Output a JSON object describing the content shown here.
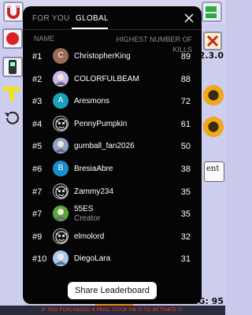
{
  "background": {
    "version": "2.3.0",
    "hint_text": "ent",
    "rank_display": "NG: 95",
    "bottom_notice": "IF YOU PURCHASED A PASS, CLICK ON IT TO ACTIVATE IT."
  },
  "leaderboard": {
    "tabs": [
      {
        "label": "FOR YOU",
        "active": false
      },
      {
        "label": "GLOBAL",
        "active": true
      }
    ],
    "columns": {
      "name": "NAME",
      "score": "HIGHEST NUMBER OF KILLS"
    },
    "entries": [
      {
        "rank": "#1",
        "name": "ChristopherKing",
        "kills": "89",
        "avatar": "letter",
        "avatar_letter": "C",
        "avatar_color": "#9b6b58"
      },
      {
        "rank": "#2",
        "name": "COLORFULBEAM",
        "kills": "88",
        "avatar": "image",
        "avatar_color": "#c8b8e8"
      },
      {
        "rank": "#3",
        "name": "Aresmons",
        "kills": "72",
        "avatar": "letter",
        "avatar_letter": "A",
        "avatar_color": "#17a2b8"
      },
      {
        "rank": "#4",
        "name": "PennyPumpkin",
        "kills": "61",
        "avatar": "pattern",
        "avatar_color": "#111111"
      },
      {
        "rank": "#5",
        "name": "gumball_fan2026",
        "kills": "50",
        "avatar": "image",
        "avatar_color": "#8fa3c8"
      },
      {
        "rank": "#6",
        "name": "BresiaAbre",
        "kills": "38",
        "avatar": "letter",
        "avatar_letter": "B",
        "avatar_color": "#1a8fcf"
      },
      {
        "rank": "#7",
        "name": "Zammy234",
        "kills": "35",
        "avatar": "pattern",
        "avatar_color": "#111111"
      },
      {
        "rank": "#7",
        "name": "55ES",
        "subtitle": "Creator",
        "kills": "35",
        "avatar": "image",
        "avatar_color": "#5aa83a"
      },
      {
        "rank": "#9",
        "name": "elmolord",
        "kills": "32",
        "avatar": "pattern",
        "avatar_color": "#111111"
      },
      {
        "rank": "#10",
        "name": "DiegoLara",
        "kills": "31",
        "avatar": "image",
        "avatar_color": "#a8c8f0"
      }
    ],
    "share_label": "Share Leaderboard"
  }
}
